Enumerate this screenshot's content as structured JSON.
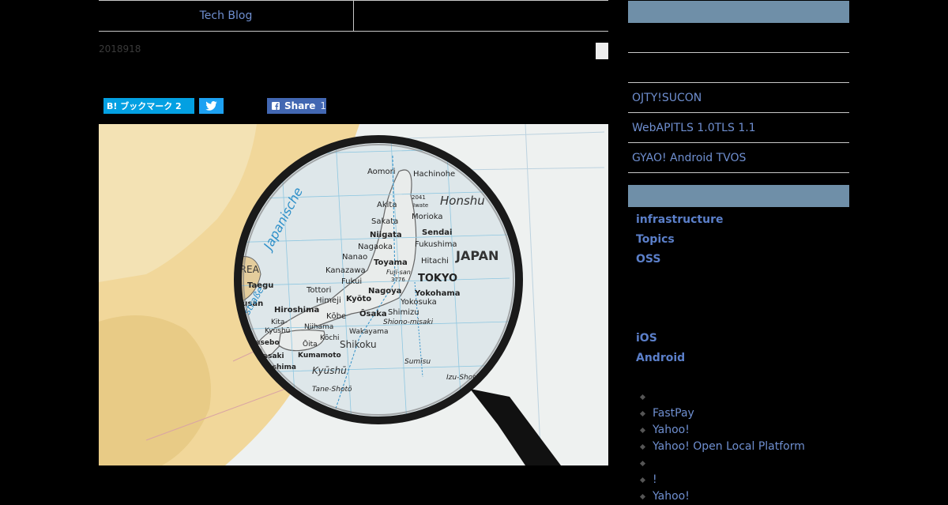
{
  "topnav": {
    "left_label": "Tech Blog",
    "right_label": ""
  },
  "post": {
    "date": "2018918"
  },
  "share": {
    "hatena_label": "B! ブックマーク 2",
    "facebook_label": "Share",
    "facebook_count": "1"
  },
  "hero_map": {
    "labels": {
      "aomori": "Aomori",
      "hachinohe": "Hachinohe",
      "honshu": "Honshu",
      "akita": "Akita",
      "morioka": "Morioka",
      "sakata": "Sakata",
      "sendai": "Sendai",
      "niigata": "Niigata",
      "fukushima": "Fukushima",
      "nagaoka": "Nagaoka",
      "japan": "JAPAN",
      "toyama": "Toyama",
      "hitachi": "Hitachi",
      "nanao": "Nanao",
      "kanazawa": "Kanazawa",
      "fujisan": "Fuji-san",
      "fuji_elev": "3776",
      "tokyo": "TOKYO",
      "fukui": "Fukui",
      "korea": "KOREA",
      "taegu": "Taegu",
      "pusan": "Pusan",
      "tottori": "Tottori",
      "himeji": "Himeji",
      "kyoto": "Kyōto",
      "nagoya": "Nagoya",
      "yokohama": "Yokohama",
      "yokosuka": "Yokosuka",
      "hiroshima": "Hiroshima",
      "kobe": "Kōbe",
      "osaka": "Ōsaka",
      "shimizu": "Shimizu",
      "shiono": "Shiono-misaki",
      "kita": "Kita-",
      "kyushu_prefix": "Kyūshū",
      "niihama": "Niihama",
      "wakayama": "Wakayama",
      "sasebo": "Sasebo",
      "oita": "Ōita",
      "kochi": "Kōchi",
      "shikoku": "Shikoku",
      "nagasaki": "Nagasaki",
      "kumamoto": "Kumamoto",
      "kagoshima": "Kagoshima",
      "kyushu": "Kyūshū",
      "sumisu": "Sumisu",
      "izu_shoto": "Izu-Shotō",
      "tane_shoto": "Tane-Shotō",
      "japanische": "Japanische",
      "strasse": "straße",
      "elev_2041": "2041",
      "iwate": "Iwate"
    }
  },
  "sidebar": {
    "recent_links": [
      "OJTY!SUCON",
      "WebAPITLS 1.0TLS 1.1",
      "GYAO! Android TVOS"
    ],
    "categories_top": [
      "infrastructure",
      "Topics",
      "OSS"
    ],
    "categories_bottom": [
      "iOS",
      "Android"
    ],
    "tags": [
      "",
      "FastPay",
      "Yahoo!",
      "Yahoo! Open Local Platform",
      "",
      "!",
      "Yahoo!"
    ]
  },
  "colors": {
    "accent_link": "#5b7fc9",
    "sidebar_bar": "#6f8fa8",
    "hatena": "#03a0e2",
    "twitter": "#1da1f2",
    "facebook": "#4267b2"
  }
}
